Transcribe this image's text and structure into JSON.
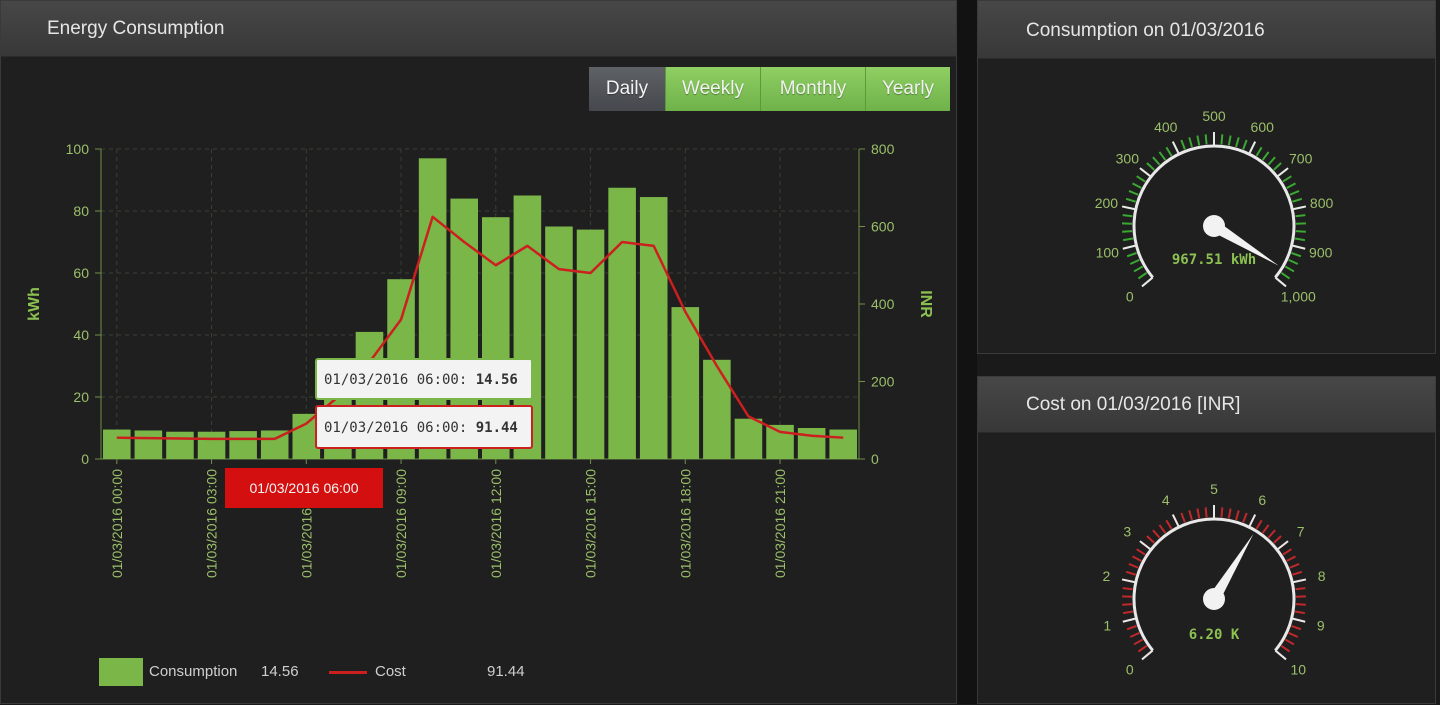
{
  "energy": {
    "title": "Energy Consumption",
    "buttons": [
      {
        "label": "Daily",
        "active": true
      },
      {
        "label": "Weekly",
        "active": false
      },
      {
        "label": "Monthly",
        "active": false
      },
      {
        "label": "Yearly",
        "active": false
      }
    ],
    "tooltip_consumption": {
      "time": "01/03/2016 06:00:",
      "value": "14.56"
    },
    "tooltip_cost": {
      "time": "01/03/2016 06:00:",
      "value": "91.44"
    },
    "crosshair_label": "01/03/2016 06:00",
    "legend": {
      "consumption_label": "Consumption",
      "consumption_value": "14.56",
      "cost_label": "Cost",
      "cost_value": "91.44",
      "consumption_color": "#7ab648",
      "cost_color": "#cc1f1f"
    }
  },
  "chart_data": {
    "type": "bar",
    "x": [
      "01/03/2016 00:00",
      "01/03/2016 01:00",
      "01/03/2016 02:00",
      "01/03/2016 03:00",
      "01/03/2016 04:00",
      "01/03/2016 05:00",
      "01/03/2016 06:00",
      "01/03/2016 07:00",
      "01/03/2016 08:00",
      "01/03/2016 09:00",
      "01/03/2016 10:00",
      "01/03/2016 11:00",
      "01/03/2016 12:00",
      "01/03/2016 13:00",
      "01/03/2016 14:00",
      "01/03/2016 15:00",
      "01/03/2016 16:00",
      "01/03/2016 17:00",
      "01/03/2016 18:00",
      "01/03/2016 19:00",
      "01/03/2016 20:00",
      "01/03/2016 21:00",
      "01/03/2016 22:00",
      "01/03/2016 23:00"
    ],
    "x_tick_labels": [
      "01/03/2016 00:00",
      "01/03/2016 03:00",
      "01/03/2016 06:00",
      "01/03/2016 09:00",
      "01/03/2016 12:00",
      "01/03/2016 15:00",
      "01/03/2016 18:00",
      "01/03/2016 21:00"
    ],
    "series": [
      {
        "name": "Consumption",
        "axis": "left",
        "type": "bar",
        "color": "#7ab648",
        "values": [
          9.5,
          9.2,
          8.8,
          8.8,
          9,
          9.2,
          14.56,
          24,
          41,
          58,
          97,
          84,
          78,
          85,
          75,
          74,
          87.5,
          84.5,
          49,
          32,
          13,
          11,
          10,
          9.5
        ]
      },
      {
        "name": "Cost",
        "axis": "right",
        "type": "line",
        "color": "#cc1f1f",
        "values": [
          55,
          54,
          53,
          52,
          52,
          52,
          91.44,
          160,
          250,
          360,
          625,
          560,
          500,
          550,
          490,
          480,
          560,
          550,
          380,
          240,
          110,
          70,
          60,
          55
        ]
      }
    ],
    "ylabel": "kWh",
    "y2label": "INR",
    "ylim": [
      0,
      100
    ],
    "y2lim": [
      0,
      800
    ],
    "yticks": [
      0,
      20,
      40,
      60,
      80,
      100
    ],
    "y2ticks": [
      0,
      200,
      400,
      600,
      800
    ],
    "grid": true
  },
  "gauge_consumption": {
    "title": "Consumption on 01/03/2016",
    "min": 0,
    "max": 1000,
    "value": 967.51,
    "labels": [
      "0",
      "100",
      "200",
      "300",
      "400",
      "500",
      "600",
      "700",
      "800",
      "900",
      "1,000"
    ],
    "value_text": "967.51 kWh",
    "band_color": "#3aa832"
  },
  "gauge_cost": {
    "title": "Cost on 01/03/2016 [INR]",
    "min": 0,
    "max": 10,
    "value": 6.2,
    "labels": [
      "0",
      "1",
      "2",
      "3",
      "4",
      "5",
      "6",
      "7",
      "8",
      "9",
      "10"
    ],
    "value_text": "6.20 K",
    "band_color": "#c0282a"
  }
}
